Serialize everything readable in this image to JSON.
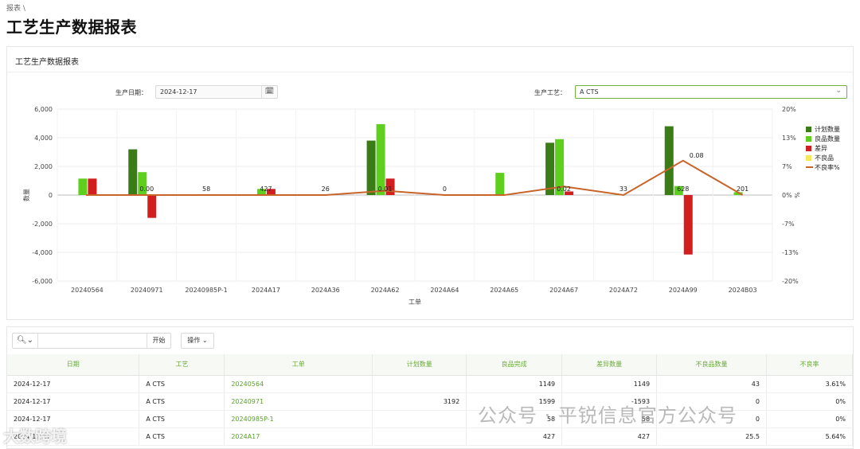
{
  "breadcrumb": "报表 \\",
  "page_title": "工艺生产数据报表",
  "card_title": "工艺生产数据报表",
  "filters": {
    "date_label": "生产日期：",
    "date_value": "2024-12-17",
    "process_label": "生产工艺：",
    "process_value": "A CTS"
  },
  "colors": {
    "plan": "#3a7d17",
    "good": "#5fcf1f",
    "diff": "#d21e1e",
    "bad": "#f5e95a",
    "rate": "#c8642a",
    "accent": "#6db33f"
  },
  "legend": [
    "计划数量",
    "良品数量",
    "差异",
    "不良品",
    "不良率%"
  ],
  "chart_data": {
    "type": "bar",
    "xlabel": "工单",
    "ylabel": "数量",
    "y2label": "%",
    "ylim": [
      -6000,
      6000
    ],
    "yticks": [
      "6,000",
      "4,000",
      "2,000",
      "0",
      "-2,000",
      "-4,000",
      "-6,000"
    ],
    "y2ticks": [
      "20%",
      "13%",
      "7%",
      "0%",
      "-7%",
      "-13%",
      "-20%"
    ],
    "categories": [
      "20240564",
      "20240971",
      "20240985P-1",
      "2024A17",
      "2024A36",
      "2024A62",
      "2024A64",
      "2024A65",
      "2024A67",
      "2024A72",
      "2024A99",
      "2024B03"
    ],
    "series": [
      {
        "name": "计划数量",
        "values": [
          0,
          3192,
          0,
          0,
          0,
          3800,
          0,
          0,
          3650,
          0,
          4800,
          0
        ]
      },
      {
        "name": "良品数量",
        "values": [
          1149,
          1599,
          58,
          427,
          26,
          4950,
          0,
          1550,
          3900,
          33,
          628,
          201
        ]
      },
      {
        "name": "差异",
        "values": [
          1149,
          -1593,
          58,
          427,
          26,
          1150,
          0,
          0,
          250,
          0,
          -4150,
          0
        ]
      },
      {
        "name": "不良品",
        "values": [
          43,
          0,
          0,
          25.5,
          0,
          0,
          0,
          0,
          0,
          0,
          0,
          0
        ]
      },
      {
        "name": "不良率%",
        "values": [
          0,
          0,
          0,
          0,
          0,
          0.01,
          0,
          0,
          0.02,
          0,
          0.08,
          0
        ]
      }
    ],
    "data_labels": [
      "",
      "0.00",
      "58",
      "427",
      "26",
      "0.01",
      "0",
      "",
      "0.02",
      "33",
      "628",
      "201"
    ],
    "rate_label": "0.08"
  },
  "toolbar": {
    "search_placeholder": "",
    "start_label": "开始",
    "ops_label": "操作"
  },
  "table": {
    "headers": [
      "日期",
      "工艺",
      "工单",
      "计划数量",
      "良品完成",
      "差异数量",
      "不良品数量",
      "不良率"
    ],
    "rows": [
      [
        "2024-12-17",
        "A CTS",
        "20240564",
        "",
        "1149",
        "1149",
        "43",
        "3.61%"
      ],
      [
        "2024-12-17",
        "A CTS",
        "20240971",
        "3192",
        "1599",
        "-1593",
        "0",
        "0%"
      ],
      [
        "2024-12-17",
        "A CTS",
        "20240985P-1",
        "",
        "58",
        "58",
        "0",
        "0%"
      ],
      [
        "2024-12-17",
        "A CTS",
        "2024A17",
        "",
        "427",
        "427",
        "25.5",
        "5.64%"
      ]
    ]
  },
  "watermark": "公众号 · 平锐信息官方公众号",
  "watermark2": "大数跨境"
}
